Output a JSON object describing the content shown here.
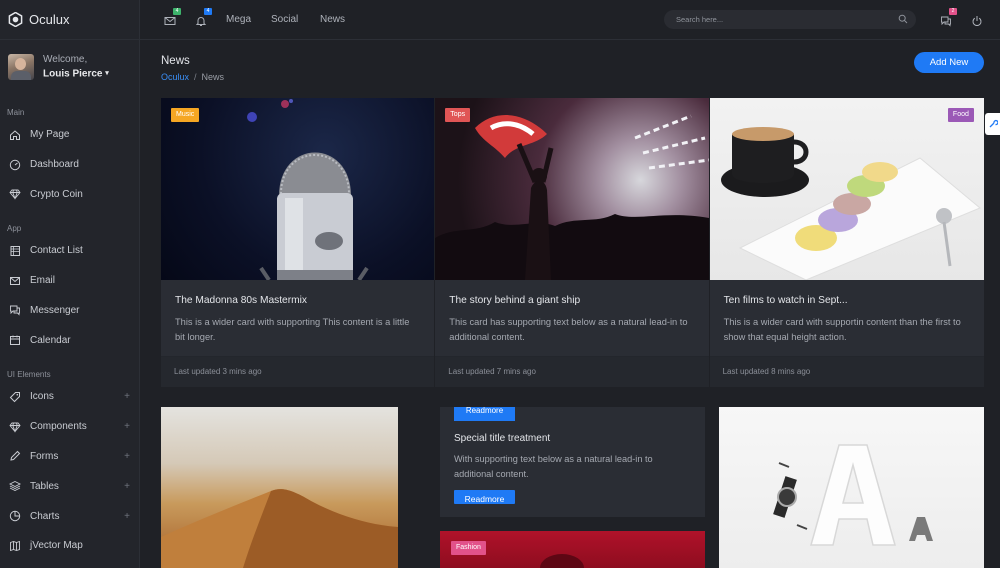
{
  "brand": {
    "name": "Oculux"
  },
  "user": {
    "welcome": "Welcome,",
    "name": "Louis Pierce",
    "caret": "▾"
  },
  "sidebar": {
    "sections": [
      {
        "title": "Main",
        "items": [
          {
            "label": "My Page",
            "icon": "home-icon"
          },
          {
            "label": "Dashboard",
            "icon": "gauge-icon"
          },
          {
            "label": "Crypto Coin",
            "icon": "diamond-icon"
          }
        ]
      },
      {
        "title": "App",
        "items": [
          {
            "label": "Contact List",
            "icon": "address-book-icon"
          },
          {
            "label": "Email",
            "icon": "envelope-icon"
          },
          {
            "label": "Messenger",
            "icon": "chat-icon"
          },
          {
            "label": "Calendar",
            "icon": "calendar-icon"
          }
        ]
      },
      {
        "title": "UI Elements",
        "items": [
          {
            "label": "Icons",
            "icon": "tag-icon",
            "expand": "+"
          },
          {
            "label": "Components",
            "icon": "diamond-icon",
            "expand": "+"
          },
          {
            "label": "Forms",
            "icon": "pencil-icon",
            "expand": "+"
          },
          {
            "label": "Tables",
            "icon": "layers-icon",
            "expand": "+"
          },
          {
            "label": "Charts",
            "icon": "pie-chart-icon",
            "expand": "+"
          },
          {
            "label": "jVector Map",
            "icon": "map-icon"
          }
        ]
      }
    ]
  },
  "topbar": {
    "mail_badge": "4",
    "bell_badge": "4",
    "links": [
      "Mega",
      "Social",
      "News"
    ],
    "search_placeholder": "Search here...",
    "chat_badge": "2"
  },
  "header": {
    "title": "News",
    "breadcrumb": {
      "home": "Oculux",
      "separator": "/",
      "current": "News"
    },
    "add_button": "Add New"
  },
  "cards": [
    {
      "tag": "Music",
      "tag_color": "#f5a623",
      "title": "The Madonna 80s Mastermix",
      "text": "This is a wider card with supporting This content is a little bit longer.",
      "footer": "Last updated 3 mins ago"
    },
    {
      "tag": "Tops",
      "tag_color": "#e05555",
      "title": "The story behind a giant ship",
      "text": "This card has supporting text below as a natural lead-in to additional content.",
      "footer": "Last updated 7 mins ago"
    },
    {
      "tag": "Food",
      "tag_color": "#9b59b6",
      "title": "Ten films to watch in Sept...",
      "text": "This is a wider card with supportin content than the first to show that equal height action.",
      "footer": "Last updated 8 mins ago"
    }
  ],
  "mid_card": {
    "readmore_top": "Readmore",
    "title": "Special title treatment",
    "text": "With supporting text below as a natural lead-in to additional content.",
    "readmore": "Readmore"
  },
  "fashion": {
    "tag": "Fashion",
    "tag_color": "#e2528a"
  },
  "colors": {
    "accent": "#1f7af5",
    "sidebar_bg": "#23252b",
    "page_bg": "#1f2126",
    "card_bg": "#2a2d34"
  }
}
